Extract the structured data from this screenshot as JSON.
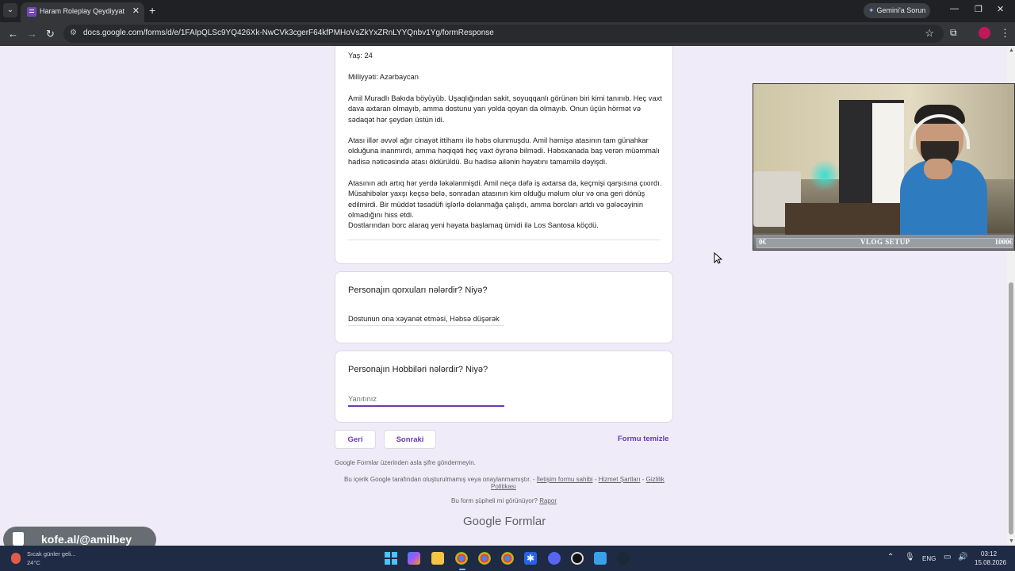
{
  "browser": {
    "tab_title": "Haram Roleplay Qeydiyyat",
    "tab_close": "✕",
    "new_tab": "+",
    "gemini_label": "Gemini'a Sorun",
    "url": "docs.google.com/forms/d/e/1FAIpQLSc9YQ426Xk-NwCVk3cgerF64kfPMHoVsZkYxZRnLYYQnbv1Yg/formResponse",
    "icons": [
      "back-icon",
      "forward-icon",
      "reload-icon",
      "site-info-icon",
      "bookmark-star-icon",
      "extensions-icon",
      "profile-icon",
      "menu-icon"
    ],
    "window_controls": [
      "—",
      "❐",
      "✕"
    ]
  },
  "form": {
    "bio": {
      "age_line": "Yaş: 24",
      "nationality_line": "Milliyyəti: Azərbaycan",
      "paragraph_1": "Amil Muradlı Bakıda böyüyüb. Uşaqlığından sakit, soyuqqanlı görünən biri kimi tanınıb. Heç vaxt dava axtaran olmayıb, amma dostunu yarı yolda qoyan da olmayıb. Onun üçün hörmət və sədaqət hər şeydən üstün idi.",
      "paragraph_2": "Atası illər əvvəl ağır cinayət ittihamı ilə həbs olunmuşdu. Amil həmişə atasının tam günahkar olduğuna inanmırdı, amma həqiqəti heç vaxt öyrənə bilmədi. Həbsxanada baş verən müəmmalı hadisə nəticəsində atası öldürüldü. Bu hadisə ailənin həyatını tamamilə dəyişdi.",
      "paragraph_3": "Atasının adı artıq hər yerdə ləkələnmişdi. Amil neçə dəfə iş axtarsa da, keçmişi qarşısına çıxırdı. Müsahibələr yaxşı keçsə belə, sonradan atasının kim olduğu məlum olur və ona geri dönüş edilmirdi. Bir müddət təsadüfi işlərlə dolanmağa çalışdı, amma borcları artdı və gələcəyinin olmadığını hiss etdi.",
      "paragraph_4": "Dostlarından borc alaraq yeni həyata başlamaq ümidi ilə Los Santosa köçdü."
    },
    "fears_question": "Personajın qorxuları nələrdir? Niyə?",
    "fears_answer": "Dostunun ona xəyanət etməsi, Həbsə düşərək",
    "hobbies_question": "Personajın Hobbiləri nələrdir? Niyə?",
    "hobbies_placeholder": "Yanıtınız",
    "back_button": "Geri",
    "next_button": "Sonraki",
    "clear_link": "Formu temizle"
  },
  "footer": {
    "password_warning": "Google Formlar üzerinden asla şifre göndermeyin.",
    "disclaimer": "Bu içerik Google tarafından oluşturulmamış veya onaylanmamıştır. -",
    "contact_link": "İletişim formu sahibi",
    "sep1": "-",
    "terms_link": "Hizmet Şartları",
    "sep2": "-",
    "privacy_link_1": "Gizlilik",
    "privacy_link_2": "Politikası",
    "suspicious": "Bu form şüpheli mi görünüyor?",
    "report_link": "Rapor",
    "logo_google": "Google",
    "logo_forms": "Formlar"
  },
  "webcam": {
    "bar_left": "0€",
    "bar_center": "VLOG SETUP",
    "bar_right": "1000€"
  },
  "promo": {
    "text": "kofe.al/@amilbey",
    "icon": "coffee-cup-icon"
  },
  "taskbar": {
    "weather_text": "Sıcak günler geli...",
    "weather_temp": "24°C",
    "language": "ENG",
    "time": "03:12",
    "date": "15.08.2026"
  }
}
